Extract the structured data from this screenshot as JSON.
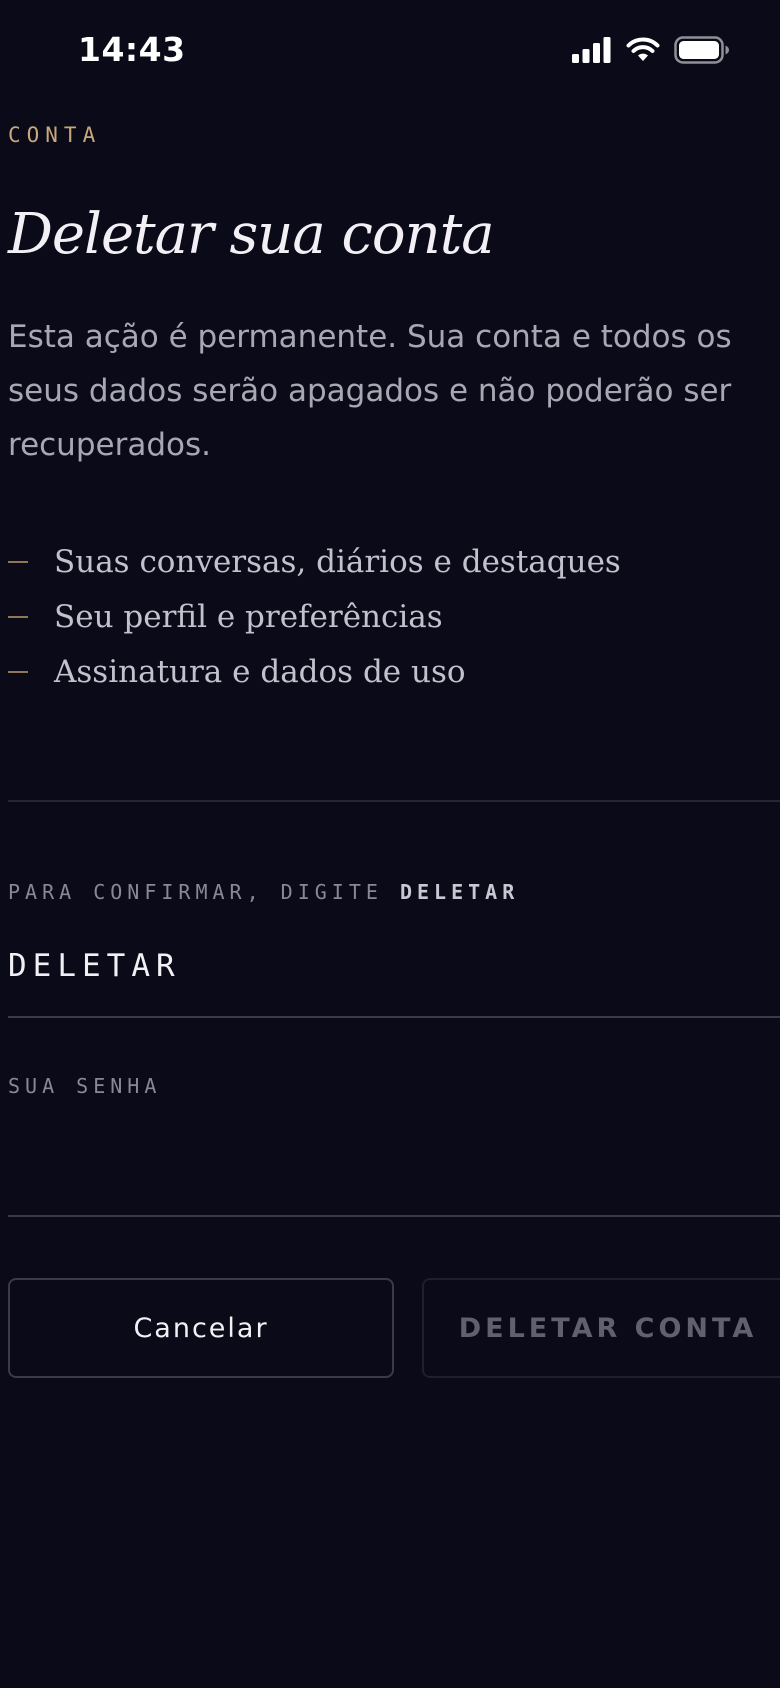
{
  "status_bar": {
    "time": "14:43",
    "icons": [
      "signal-icon",
      "wifi-icon",
      "battery-icon"
    ]
  },
  "header": {
    "eyebrow": "CONTA",
    "title": "Deletar sua conta"
  },
  "description": "Esta ação é permanente. Sua conta e todos os seus dados serão apagados e não poderão ser recuperados.",
  "items": [
    {
      "label": "Suas conversas, diários e destaques"
    },
    {
      "label": "Seu perfil e preferências"
    },
    {
      "label": "Assinatura e dados de uso"
    }
  ],
  "confirm": {
    "label_prefix": "PARA CONFIRMAR, DIGITE",
    "label_keyword": "DELETAR",
    "value": "DELETAR"
  },
  "password": {
    "label": "SUA SENHA",
    "value": ""
  },
  "buttons": {
    "cancel": "Cancelar",
    "delete": "DELETAR CONTA"
  },
  "colors": {
    "background": "#0a0a18",
    "accent": "#c9a77a",
    "text_primary": "#f2f0f4",
    "text_muted": "#a9a7b3",
    "disabled": "#62606f"
  }
}
